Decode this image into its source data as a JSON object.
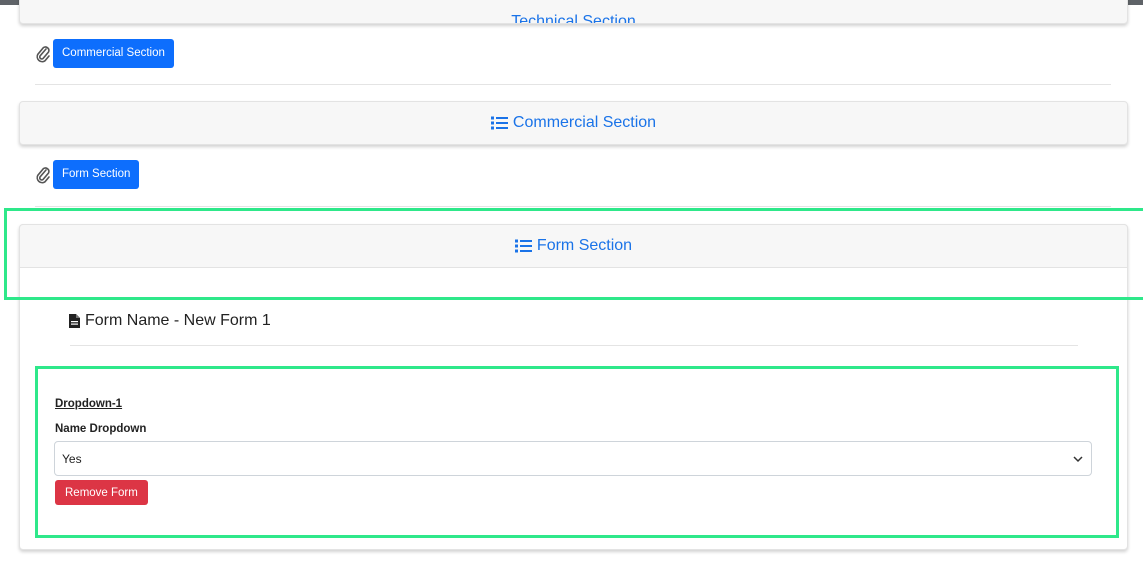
{
  "top_header": {
    "label": "Technical Section"
  },
  "section1": {
    "attach_button": "Commercial Section"
  },
  "commercial_header": {
    "label": "Commercial Section"
  },
  "section2": {
    "attach_button": "Form Section"
  },
  "form_section": {
    "header": "Form Section",
    "form_name": "Form Name - New Form 1",
    "field_group_title": "Dropdown-1",
    "field_label": "Name Dropdown",
    "select_value": "Yes",
    "remove_button": "Remove Form"
  },
  "icons": {
    "list": "list-icon",
    "paperclip": "paperclip-icon",
    "document": "document-icon",
    "chevron": "chevron-down-icon"
  },
  "colors": {
    "primary": "#0d6efd",
    "header_text": "#1a73e8",
    "danger": "#dc3545",
    "highlight": "#2ee88a"
  }
}
